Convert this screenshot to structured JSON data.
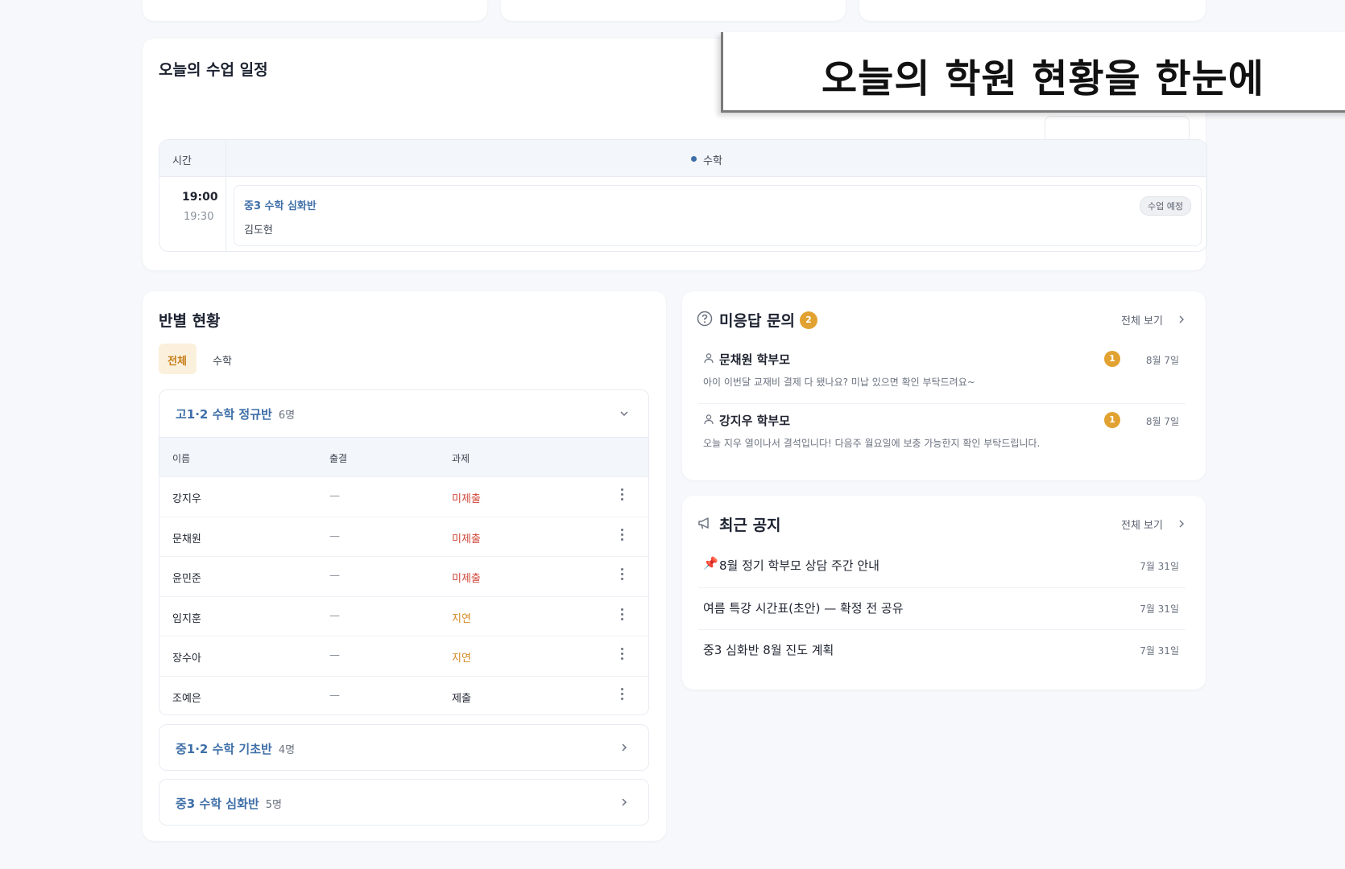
{
  "banner": {
    "title": "오늘의 학원 현황을 한눈에"
  },
  "schedule": {
    "title": "오늘의 수업 일정",
    "col_time": "시간",
    "col_subject": "수학",
    "subject_color": "#3f6fa8",
    "item": {
      "start": "19:00",
      "end": "19:30",
      "class_name": "중3 수학 심화반",
      "teacher": "김도현",
      "status": "수업 예정"
    }
  },
  "classes": {
    "title": "반별 현황",
    "tabs": [
      {
        "label": "전체",
        "active": true
      },
      {
        "label": "수학",
        "active": false
      }
    ],
    "open_group": {
      "name": "고1·2 수학 정규반",
      "count": "6명",
      "headers": {
        "name": "이름",
        "attendance": "출결",
        "homework": "과제"
      },
      "rows": [
        {
          "name": "강지우",
          "attendance": "—",
          "homework": "미제출",
          "status": "red"
        },
        {
          "name": "문채원",
          "attendance": "—",
          "homework": "미제출",
          "status": "red"
        },
        {
          "name": "윤민준",
          "attendance": "—",
          "homework": "미제출",
          "status": "red"
        },
        {
          "name": "임지훈",
          "attendance": "—",
          "homework": "지연",
          "status": "orange"
        },
        {
          "name": "장수아",
          "attendance": "—",
          "homework": "지연",
          "status": "orange"
        },
        {
          "name": "조예은",
          "attendance": "—",
          "homework": "제출",
          "status": "normal"
        }
      ]
    },
    "groups": [
      {
        "name": "중1·2 수학 기초반",
        "count": "4명"
      },
      {
        "name": "중3 수학 심화반",
        "count": "5명"
      }
    ]
  },
  "inquiries": {
    "title": "미응답 문의",
    "count": "2",
    "see_all": "전체 보기",
    "items": [
      {
        "from": "문채원 학부모",
        "unread": "1",
        "date": "8월 7일",
        "message": "아이 이번달 교재비 결제 다 됐나요? 미납 있으면 확인 부탁드려요~"
      },
      {
        "from": "강지우 학부모",
        "unread": "1",
        "date": "8월 7일",
        "message": "오늘 지우 열이나서 결석입니다! 다음주 월요일에 보충 가능한지 확인 부탁드립니다."
      }
    ]
  },
  "notices": {
    "title": "최근 공지",
    "see_all": "전체 보기",
    "items": [
      {
        "title": "8월 정기 학부모 상담 주간 안내",
        "date": "7월 31일",
        "pinned": true
      },
      {
        "title": "여름 특강 시간표(초안) — 확정 전 공유",
        "date": "7월 31일",
        "pinned": false
      },
      {
        "title": "중3 심화반 8월 진도 계획",
        "date": "7월 31일",
        "pinned": false
      }
    ]
  }
}
